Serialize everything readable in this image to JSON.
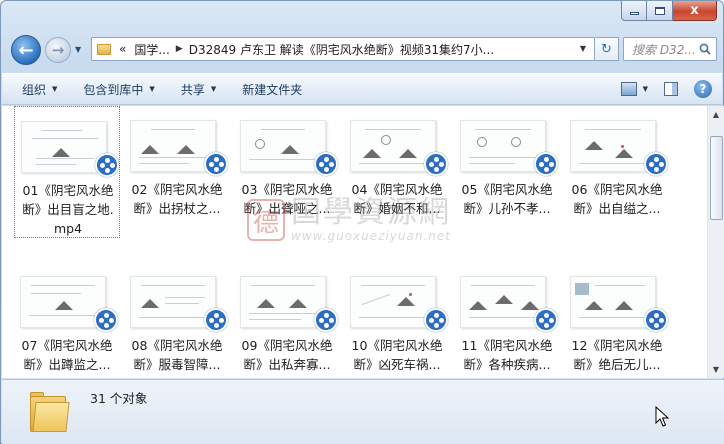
{
  "window": {
    "caption_close": "x"
  },
  "nav": {
    "back_icon": "arrow-left-icon",
    "forward_icon": "arrow-right-icon",
    "address_overflow": "«",
    "breadcrumb": [
      "国学...",
      "D32849 卢东卫 解读《阴宅风水绝断》视频31集约7小..."
    ],
    "search_placeholder": "搜索 D32..."
  },
  "toolbar": {
    "organize": "组织",
    "include_in_library": "包含到库中",
    "share": "共享",
    "new_folder": "新建文件夹"
  },
  "files": [
    {
      "line1": "01《阴宅风水绝",
      "line2": "断》出目盲之地.",
      "line3": "mp4"
    },
    {
      "line1": "02《阴宅风水绝",
      "line2": "断》出拐杖之..."
    },
    {
      "line1": "03《阴宅风水绝",
      "line2": "断》出聋哑之..."
    },
    {
      "line1": "04《阴宅风水绝",
      "line2": "断》婚姻不和..."
    },
    {
      "line1": "05《阴宅风水绝",
      "line2": "断》儿孙不孝..."
    },
    {
      "line1": "06《阴宅风水绝",
      "line2": "断》出自缢之..."
    },
    {
      "line1": "07《阴宅风水绝",
      "line2": "断》出蹲监之..."
    },
    {
      "line1": "08《阴宅风水绝",
      "line2": "断》服毒智障..."
    },
    {
      "line1": "09《阴宅风水绝",
      "line2": "断》出私奔寡..."
    },
    {
      "line1": "10《阴宅风水绝",
      "line2": "断》凶死车祸..."
    },
    {
      "line1": "11《阴宅风水绝",
      "line2": "断》各种疾病..."
    },
    {
      "line1": "12《阴宅风水绝",
      "line2": "断》绝后无儿..."
    }
  ],
  "watermark": {
    "seal": "德",
    "name": "国學資源網",
    "url": "www.guoxueziyuan.net"
  },
  "status": {
    "count": "31 个对象"
  },
  "colors": {
    "accent": "#2c6ec4",
    "selection_border": "#777777",
    "watermark": "#c0392b"
  }
}
